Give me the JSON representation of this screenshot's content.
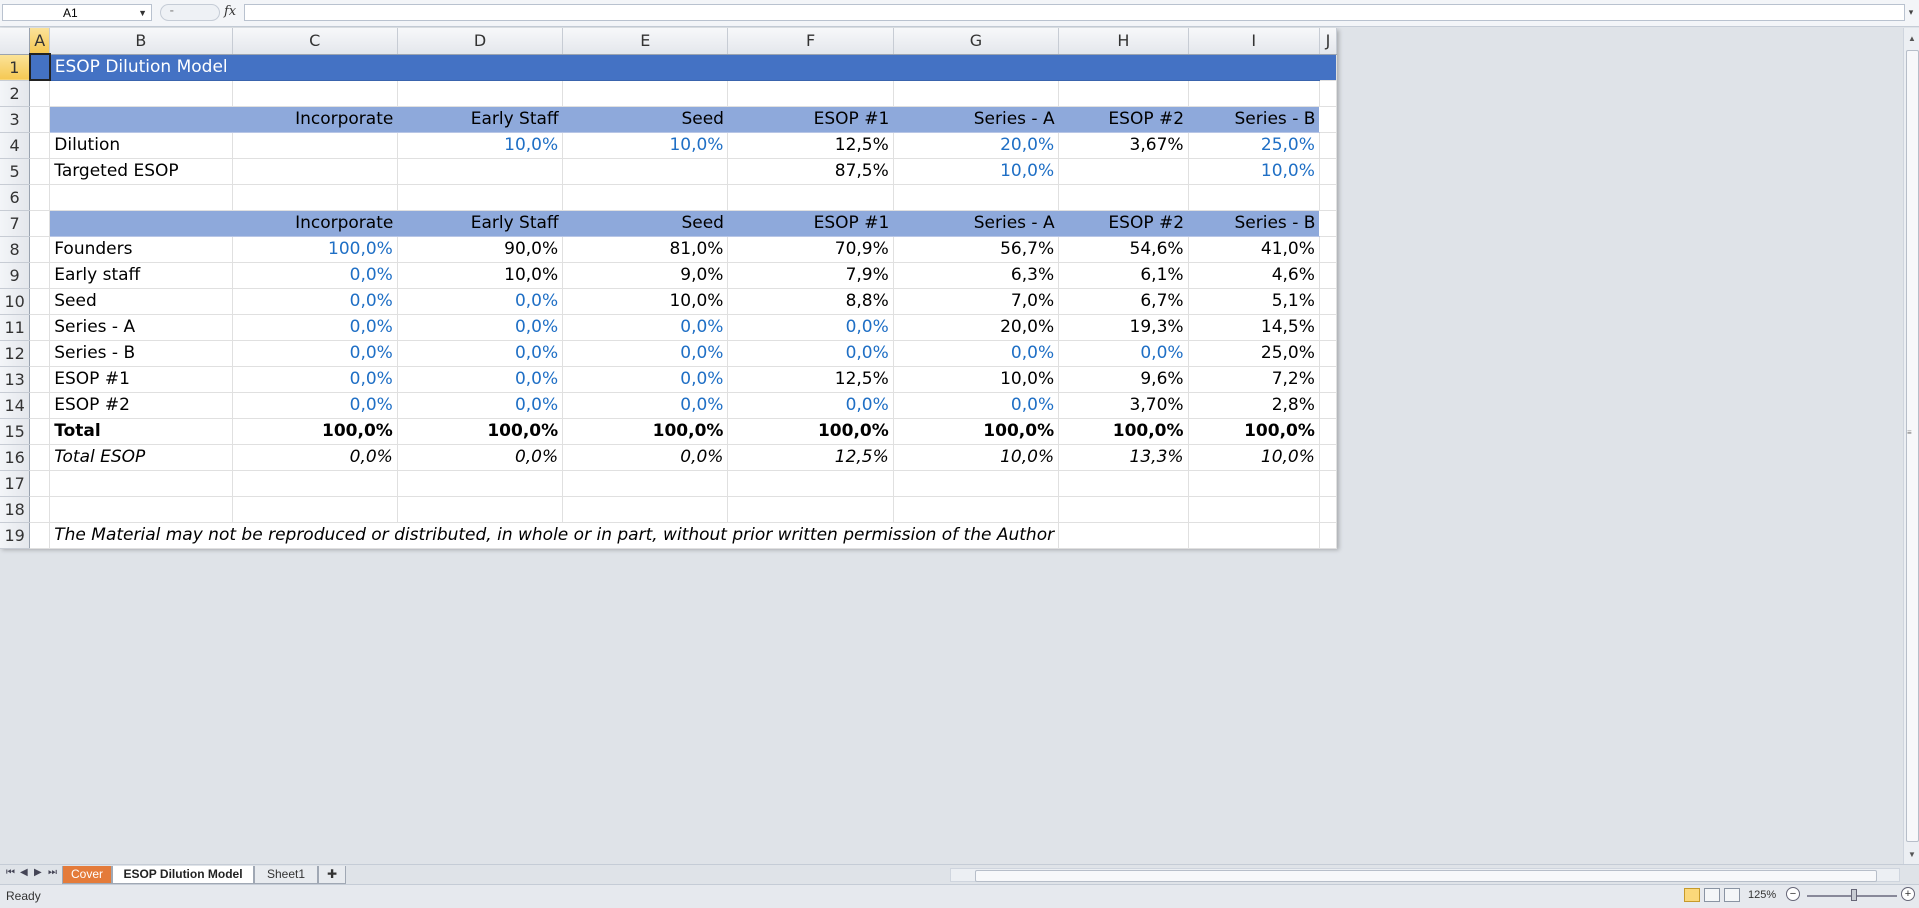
{
  "formula_bar": {
    "name_box": "A1",
    "fx": "fx",
    "formula": ""
  },
  "columns": [
    "A",
    "B",
    "C",
    "D",
    "E",
    "F",
    "G",
    "H",
    "I",
    "J"
  ],
  "rows": [
    "1",
    "2",
    "3",
    "4",
    "5",
    "6",
    "7",
    "8",
    "9",
    "10",
    "11",
    "12",
    "13",
    "14",
    "15",
    "16",
    "17",
    "18",
    "19"
  ],
  "title": "ESOP Dilution Model",
  "headers": [
    "Incorporate",
    "Early Staff",
    "Seed",
    "ESOP #1",
    "Series - A",
    "ESOP #2",
    "Series - B"
  ],
  "dilution": {
    "label": "Dilution",
    "values": [
      "",
      "10,0%",
      "10,0%",
      "12,5%",
      "20,0%",
      "3,67%",
      "25,0%"
    ]
  },
  "targeted": {
    "label": "Targeted ESOP",
    "values": [
      "",
      "",
      "",
      "87,5%",
      "10,0%",
      "",
      "10,0%"
    ]
  },
  "cap_table": [
    {
      "label": "Founders",
      "values": [
        "100,0%",
        "90,0%",
        "81,0%",
        "70,9%",
        "56,7%",
        "54,6%",
        "41,0%"
      ]
    },
    {
      "label": "Early staff",
      "values": [
        "0,0%",
        "10,0%",
        "9,0%",
        "7,9%",
        "6,3%",
        "6,1%",
        "4,6%"
      ]
    },
    {
      "label": "Seed",
      "values": [
        "0,0%",
        "0,0%",
        "10,0%",
        "8,8%",
        "7,0%",
        "6,7%",
        "5,1%"
      ]
    },
    {
      "label": "Series - A",
      "values": [
        "0,0%",
        "0,0%",
        "0,0%",
        "0,0%",
        "20,0%",
        "19,3%",
        "14,5%"
      ]
    },
    {
      "label": "Series - B",
      "values": [
        "0,0%",
        "0,0%",
        "0,0%",
        "0,0%",
        "0,0%",
        "0,0%",
        "25,0%"
      ]
    },
    {
      "label": "ESOP #1",
      "values": [
        "0,0%",
        "0,0%",
        "0,0%",
        "12,5%",
        "10,0%",
        "9,6%",
        "7,2%"
      ]
    },
    {
      "label": "ESOP #2",
      "values": [
        "0,0%",
        "0,0%",
        "0,0%",
        "0,0%",
        "0,0%",
        "3,70%",
        "2,8%"
      ]
    }
  ],
  "total": {
    "label": "Total",
    "values": [
      "100,0%",
      "100,0%",
      "100,0%",
      "100,0%",
      "100,0%",
      "100,0%",
      "100,0%"
    ]
  },
  "total_esop": {
    "label": "Total ESOP",
    "values": [
      "0,0%",
      "0,0%",
      "0,0%",
      "12,5%",
      "10,0%",
      "13,3%",
      "10,0%"
    ]
  },
  "note": "The Material may not be reproduced or distributed, in whole or in part, without prior written permission of the Author",
  "sheet_tabs": [
    "Cover",
    "ESOP Dilution Model",
    "Sheet1"
  ],
  "status": {
    "ready": "Ready",
    "zoom": "125%"
  },
  "colors": {
    "title_bg": "#4472c4",
    "header_bg": "#8ea9db",
    "input_blue": "#1f6fc5",
    "cover_tab": "#e47b3a"
  }
}
